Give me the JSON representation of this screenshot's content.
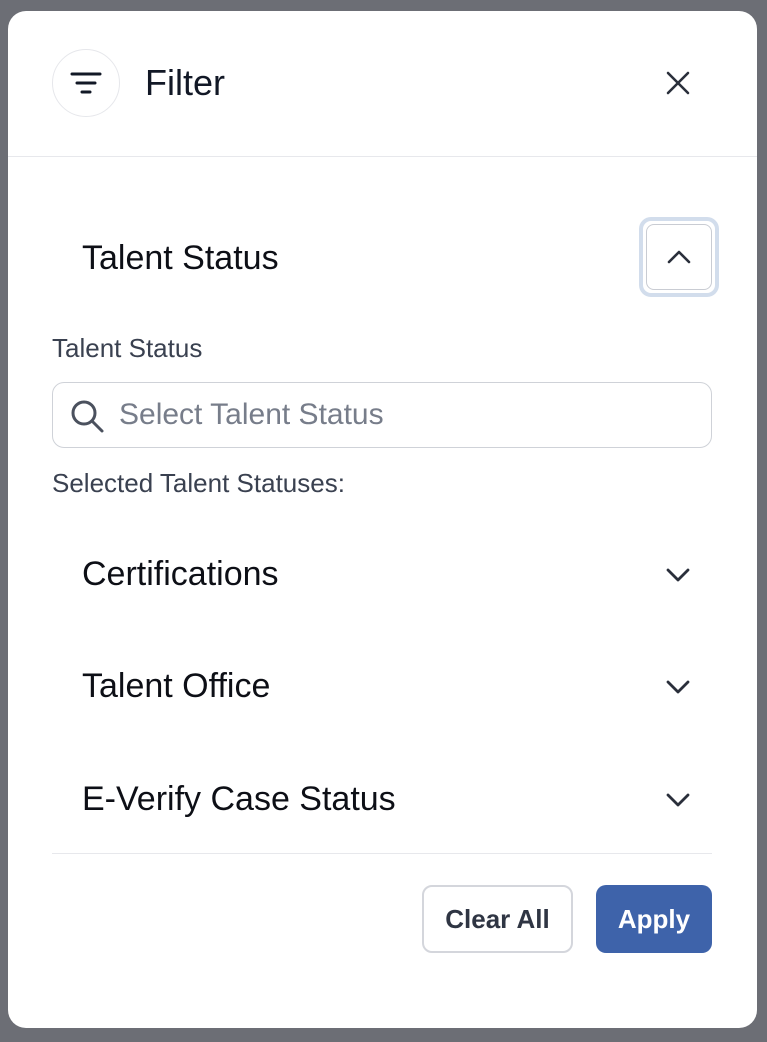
{
  "header": {
    "title": "Filter",
    "filter_icon": "filter-lines-icon",
    "close_icon": "close-icon"
  },
  "talent_status_section": {
    "title": "Talent Status",
    "toggle_icon": "chevron-up-icon",
    "field_label": "Talent Status",
    "search": {
      "placeholder": "Select Talent Status",
      "value": "",
      "icon": "search-icon"
    },
    "selected_label": "Selected Talent Statuses:"
  },
  "accordion": [
    {
      "label": "Certifications",
      "icon": "chevron-down-icon"
    },
    {
      "label": "Talent Office",
      "icon": "chevron-down-icon"
    },
    {
      "label": "E-Verify Case Status",
      "icon": "chevron-down-icon"
    }
  ],
  "footer": {
    "clear_label": "Clear All",
    "apply_label": "Apply"
  },
  "colors": {
    "backdrop": "#6c6e75",
    "primary": "#3e63aa",
    "focus_ring": "#d2ddec",
    "text_dark": "#0d0f16",
    "text_muted": "#3a4150"
  }
}
